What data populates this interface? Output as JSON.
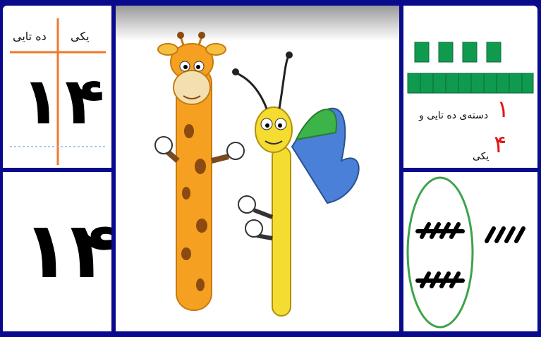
{
  "place_value_chart": {
    "ones_header": "یکی",
    "tens_header": "ده تایی",
    "ones_digit": "۴",
    "tens_digit": "۱"
  },
  "number_card": {
    "value": "۱۴"
  },
  "decomposition": {
    "tens_count": "۱",
    "tens_text": "دسته‌ی ده تایی و",
    "ones_count": "۴",
    "ones_text": "یکی"
  },
  "colors": {
    "frame": "#0a0a8c",
    "chart_lines": "#f07a2a",
    "cube_green": "#109a50",
    "red_digits": "#e01818",
    "oval_green": "#3da34a"
  }
}
